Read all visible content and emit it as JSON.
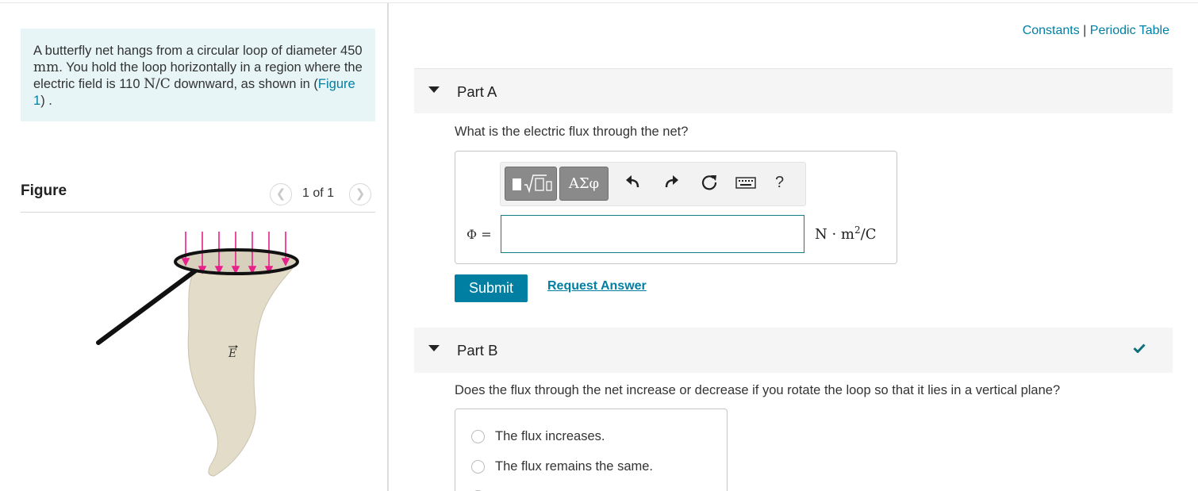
{
  "problem": {
    "text_1": "A butterfly net hangs from a circular loop of diameter 450 ",
    "unit_mm": "mm",
    "text_2": ". You hold the loop horizontally in a region where the electric field is 110 ",
    "unit_field": "N/C",
    "text_3": " downward, as shown in (",
    "figure_link": "Figure 1",
    "text_4": ") ."
  },
  "figure": {
    "title": "Figure",
    "pager": "1 of 1",
    "prev_icon": "chevron-left-icon",
    "next_icon": "chevron-right-icon",
    "field_label": "E",
    "colors": {
      "field_arrows": "#e8208a",
      "net": "#e3dcc8",
      "handle": "#111111"
    }
  },
  "header_links": {
    "constants": "Constants",
    "separator": " | ",
    "periodic_table": "Periodic Table"
  },
  "part_a": {
    "title": "Part A",
    "question": "What is the electric flux through the net?",
    "toolbar": {
      "templates_icon": "templates-icon",
      "greek_label": "ΑΣφ",
      "undo_icon": "undo-icon",
      "redo_icon": "redo-icon",
      "reset_icon": "reset-icon",
      "keyboard_icon": "keyboard-icon",
      "help_label": "?"
    },
    "variable": "Φ =",
    "answer_value": "",
    "units_prefix": "N · m",
    "units_exp": "2",
    "units_suffix": "/C",
    "submit_label": "Submit",
    "request_label": "Request Answer"
  },
  "part_b": {
    "title": "Part B",
    "status_icon": "checkmark-icon",
    "question": "Does the flux through the net increase or decrease if you rotate the loop so that it lies in a vertical plane?",
    "options": [
      "The flux increases.",
      "The flux remains the same."
    ]
  },
  "colors": {
    "accent": "#007fa3",
    "problem_bg": "#e8f5f6",
    "check": "#0f6f7a"
  }
}
